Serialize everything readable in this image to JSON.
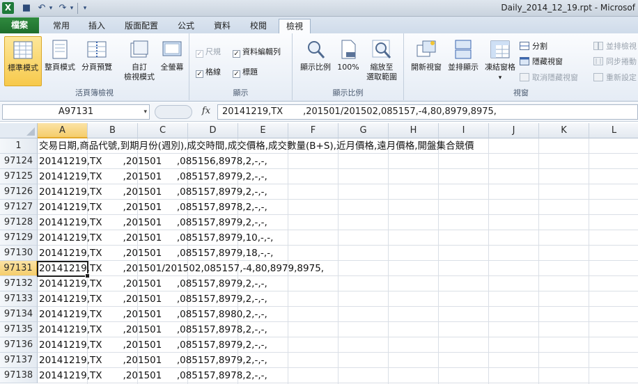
{
  "window": {
    "title": "Daily_2014_12_19.rpt - Microsof",
    "app_icon": "X"
  },
  "quick_access": {
    "save": "■",
    "undo": "↶",
    "undo_dd": "▾",
    "redo": "↷",
    "redo_dd": "▾",
    "customize": "▾"
  },
  "tabs": [
    {
      "label": "檔案"
    },
    {
      "label": "常用"
    },
    {
      "label": "插入"
    },
    {
      "label": "版面配置"
    },
    {
      "label": "公式"
    },
    {
      "label": "資料"
    },
    {
      "label": "校閱"
    },
    {
      "label": "檢視"
    }
  ],
  "ribbon": {
    "workbook_views": {
      "label": "活頁簿檢視",
      "normal": "標準模式",
      "page_layout": "整頁模式",
      "page_break": "分頁預覽",
      "custom1": "自訂",
      "custom2": "檢視模式",
      "fullscreen": "全螢幕"
    },
    "show": {
      "label": "顯示",
      "ruler": "尺規",
      "formula_bar": "資料編輯列",
      "gridlines": "格線",
      "headings": "標題",
      "check": "✓"
    },
    "zoom": {
      "label": "顯示比例",
      "zoom": "顯示比例",
      "hundred": "100%",
      "sel1": "縮放至",
      "sel2": "選取範圍"
    },
    "window": {
      "label": "視窗",
      "new_window": "開新視窗",
      "arrange_all": "並排顯示",
      "freeze": "凍結窗格",
      "freeze_dd": "▾",
      "split": "分割",
      "hide": "隱藏視窗",
      "unhide": "取消隱藏視窗",
      "side_by_side": "並排檢視",
      "sync_scroll": "同步捲動",
      "reset_pos": "重新設定"
    }
  },
  "formula_bar": {
    "name_box": "A97131",
    "name_box_dd": "▾",
    "fx": "fx",
    "content": "20141219,TX       ,201501/201502,085157,-4,80,8979,8975,"
  },
  "columns": [
    "A",
    "B",
    "C",
    "D",
    "E",
    "F",
    "G",
    "H",
    "I",
    "J",
    "K",
    "L"
  ],
  "rows": [
    {
      "num": "1",
      "text": "交易日期,商品代號,到期月份(週別),成交時間,成交價格,成交數量(B+S),近月價格,遠月價格,開盤集合競價"
    },
    {
      "num": "97124",
      "text": "20141219,TX       ,201501     ,085156,8978,2,-,-,"
    },
    {
      "num": "97125",
      "text": "20141219,TX       ,201501     ,085157,8979,2,-,-,"
    },
    {
      "num": "97126",
      "text": "20141219,TX       ,201501     ,085157,8979,2,-,-,"
    },
    {
      "num": "97127",
      "text": "20141219,TX       ,201501     ,085157,8978,2,-,-,"
    },
    {
      "num": "97128",
      "text": "20141219,TX       ,201501     ,085157,8979,2,-,-,"
    },
    {
      "num": "97129",
      "text": "20141219,TX       ,201501     ,085157,8979,10,-,-,"
    },
    {
      "num": "97130",
      "text": "20141219,TX       ,201501     ,085157,8979,18,-,-,"
    },
    {
      "num": "97131",
      "text": "20141219,TX       ,201501/201502,085157,-4,80,8979,8975,"
    },
    {
      "num": "97132",
      "text": "20141219,TX       ,201501     ,085157,8979,2,-,-,"
    },
    {
      "num": "97133",
      "text": "20141219,TX       ,201501     ,085157,8979,2,-,-,"
    },
    {
      "num": "97134",
      "text": "20141219,TX       ,201501     ,085157,8980,2,-,-,"
    },
    {
      "num": "97135",
      "text": "20141219,TX       ,201501     ,085157,8978,2,-,-,"
    },
    {
      "num": "97136",
      "text": "20141219,TX       ,201501     ,085157,8979,2,-,-,"
    },
    {
      "num": "97137",
      "text": "20141219,TX       ,201501     ,085157,8979,2,-,-,"
    },
    {
      "num": "97138",
      "text": "20141219,TX       ,201501     ,085157,8978,2,-,-,"
    }
  ],
  "colors": {
    "file_tab": "#1e6e2d",
    "selection_header": "#f5cd6b",
    "grid_line": "#dadfe6"
  }
}
